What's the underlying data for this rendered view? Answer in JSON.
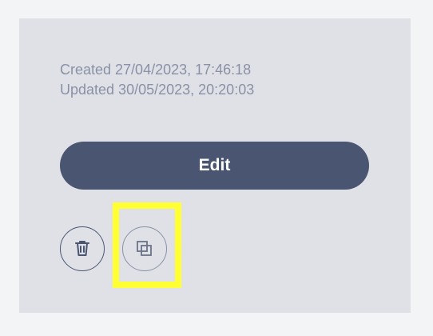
{
  "record": {
    "created": "Created 27/04/2023, 17:46:18",
    "updated": "Updated 30/05/2023, 20:20:03"
  },
  "actions": {
    "edit_label": "Edit",
    "delete_icon": "trash-icon",
    "duplicate_icon": "duplicate-icon"
  },
  "colors": {
    "background": "#f3f4f6",
    "card": "#dfe1e6",
    "meta_text": "#8a91a6",
    "primary": "#4a5572",
    "highlight": "#ffff33"
  }
}
